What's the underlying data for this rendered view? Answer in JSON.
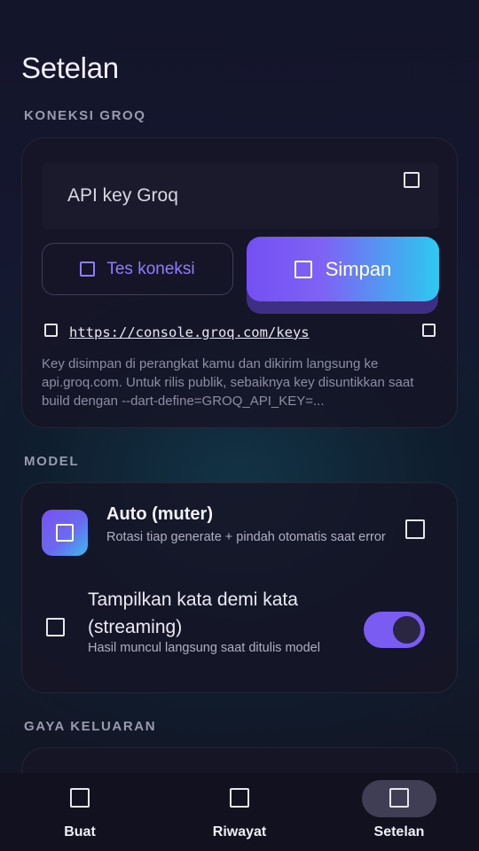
{
  "page_title": "Setelan",
  "sections": {
    "groq": {
      "label": "KONEKSI GROQ",
      "api_key_placeholder": "API key Groq",
      "api_key_value": "",
      "test_button": "Tes koneksi",
      "save_button": "Simpan",
      "link": "https://console.groq.com/keys",
      "help": "Key disimpan di perangkat kamu dan dikirim langsung ke api.groq.com. Untuk rilis publik, sebaiknya key disuntikkan saat build dengan --dart-define=GROQ_API_KEY=..."
    },
    "model": {
      "label": "MODEL",
      "name": "Auto (muter)",
      "description": "Rotasi tiap generate + pindah otomatis saat error",
      "streaming_title": "Tampilkan kata demi kata (streaming)",
      "streaming_description": "Hasil muncul langsung saat ditulis model",
      "streaming_enabled": true
    },
    "output": {
      "label": "GAYA KELUARAN"
    }
  },
  "nav": {
    "items": [
      {
        "label": "Buat",
        "icon": "create-icon",
        "active": false
      },
      {
        "label": "Riwayat",
        "icon": "history-icon",
        "active": false
      },
      {
        "label": "Setelan",
        "icon": "settings-icon",
        "active": true
      }
    ]
  },
  "colors": {
    "accent": "#7b5cf2",
    "accent_gradient_end": "#2ec9f2",
    "link_accent": "#8f7dff"
  }
}
